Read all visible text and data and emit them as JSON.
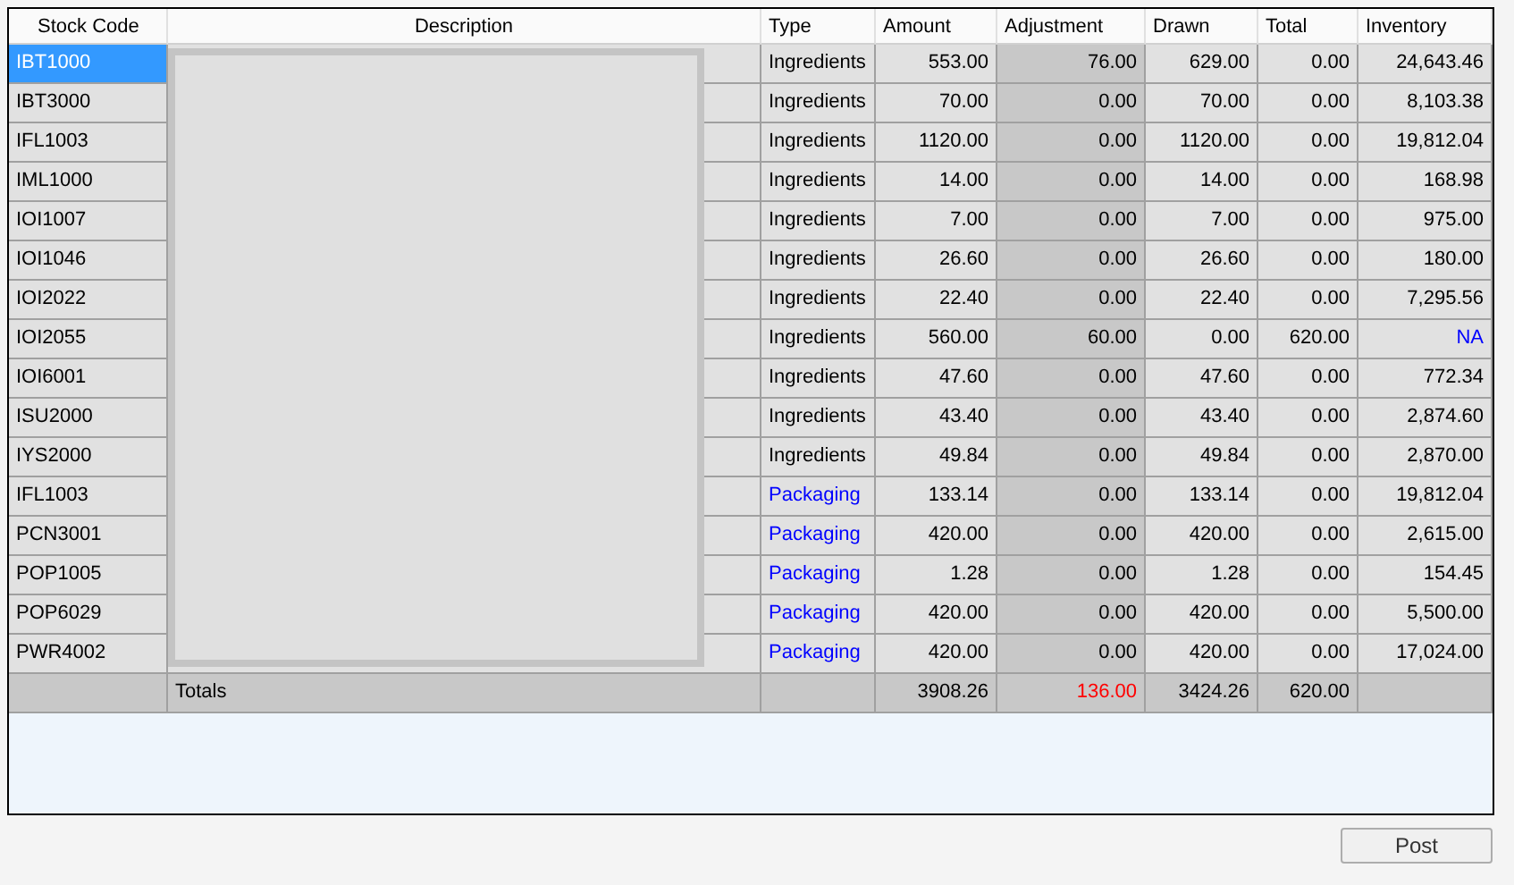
{
  "columns": [
    "Stock Code",
    "Description",
    "Type",
    "Amount",
    "Adjustment",
    "Drawn",
    "Total",
    "Inventory"
  ],
  "rows": [
    {
      "stock_code": "IBT1000",
      "selected": true,
      "type": "Ingredients",
      "type_link": false,
      "amount": "553.00",
      "adjustment": "76.00",
      "drawn": "629.00",
      "total": "0.00",
      "inventory": "24,643.46",
      "inventory_link": false
    },
    {
      "stock_code": "IBT3000",
      "selected": false,
      "type": "Ingredients",
      "type_link": false,
      "amount": "70.00",
      "adjustment": "0.00",
      "drawn": "70.00",
      "total": "0.00",
      "inventory": "8,103.38",
      "inventory_link": false
    },
    {
      "stock_code": "IFL1003",
      "selected": false,
      "type": "Ingredients",
      "type_link": false,
      "amount": "1120.00",
      "adjustment": "0.00",
      "drawn": "1120.00",
      "total": "0.00",
      "inventory": "19,812.04",
      "inventory_link": false
    },
    {
      "stock_code": "IML1000",
      "selected": false,
      "type": "Ingredients",
      "type_link": false,
      "amount": "14.00",
      "adjustment": "0.00",
      "drawn": "14.00",
      "total": "0.00",
      "inventory": "168.98",
      "inventory_link": false
    },
    {
      "stock_code": "IOI1007",
      "selected": false,
      "type": "Ingredients",
      "type_link": false,
      "amount": "7.00",
      "adjustment": "0.00",
      "drawn": "7.00",
      "total": "0.00",
      "inventory": "975.00",
      "inventory_link": false
    },
    {
      "stock_code": "IOI1046",
      "selected": false,
      "type": "Ingredients",
      "type_link": false,
      "amount": "26.60",
      "adjustment": "0.00",
      "drawn": "26.60",
      "total": "0.00",
      "inventory": "180.00",
      "inventory_link": false
    },
    {
      "stock_code": "IOI2022",
      "selected": false,
      "type": "Ingredients",
      "type_link": false,
      "amount": "22.40",
      "adjustment": "0.00",
      "drawn": "22.40",
      "total": "0.00",
      "inventory": "7,295.56",
      "inventory_link": false
    },
    {
      "stock_code": "IOI2055",
      "selected": false,
      "type": "Ingredients",
      "type_link": false,
      "amount": "560.00",
      "adjustment": "60.00",
      "drawn": "0.00",
      "total": "620.00",
      "inventory": "NA",
      "inventory_link": true
    },
    {
      "stock_code": "IOI6001",
      "selected": false,
      "type": "Ingredients",
      "type_link": false,
      "amount": "47.60",
      "adjustment": "0.00",
      "drawn": "47.60",
      "total": "0.00",
      "inventory": "772.34",
      "inventory_link": false
    },
    {
      "stock_code": "ISU2000",
      "selected": false,
      "type": "Ingredients",
      "type_link": false,
      "amount": "43.40",
      "adjustment": "0.00",
      "drawn": "43.40",
      "total": "0.00",
      "inventory": "2,874.60",
      "inventory_link": false
    },
    {
      "stock_code": "IYS2000",
      "selected": false,
      "type": "Ingredients",
      "type_link": false,
      "amount": "49.84",
      "adjustment": "0.00",
      "drawn": "49.84",
      "total": "0.00",
      "inventory": "2,870.00",
      "inventory_link": false
    },
    {
      "stock_code": "IFL1003",
      "selected": false,
      "type": "Packaging",
      "type_link": true,
      "amount": "133.14",
      "adjustment": "0.00",
      "drawn": "133.14",
      "total": "0.00",
      "inventory": "19,812.04",
      "inventory_link": false
    },
    {
      "stock_code": "PCN3001",
      "selected": false,
      "type": "Packaging",
      "type_link": true,
      "amount": "420.00",
      "adjustment": "0.00",
      "drawn": "420.00",
      "total": "0.00",
      "inventory": "2,615.00",
      "inventory_link": false
    },
    {
      "stock_code": "POP1005",
      "selected": false,
      "type": "Packaging",
      "type_link": true,
      "amount": "1.28",
      "adjustment": "0.00",
      "drawn": "1.28",
      "total": "0.00",
      "inventory": "154.45",
      "inventory_link": false
    },
    {
      "stock_code": "POP6029",
      "selected": false,
      "type": "Packaging",
      "type_link": true,
      "amount": "420.00",
      "adjustment": "0.00",
      "drawn": "420.00",
      "total": "0.00",
      "inventory": "5,500.00",
      "inventory_link": false
    },
    {
      "stock_code": "PWR4002",
      "selected": false,
      "type": "Packaging",
      "type_link": true,
      "amount": "420.00",
      "adjustment": "0.00",
      "drawn": "420.00",
      "total": "0.00",
      "inventory": "17,024.00",
      "inventory_link": false
    }
  ],
  "totals": {
    "label": "Totals",
    "amount": "3908.26",
    "adjustment": "136.00",
    "adjustment_flagged": true,
    "drawn": "3424.26",
    "total": "620.00"
  },
  "buttons": [
    "Post"
  ]
}
